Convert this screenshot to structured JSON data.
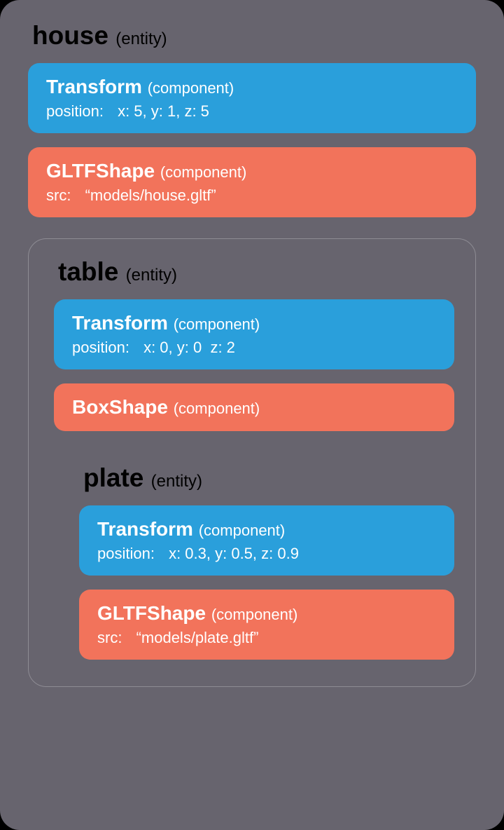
{
  "entities": {
    "house": {
      "name": "house",
      "tag": "(entity)",
      "transform": {
        "title": "Transform",
        "tag": "(component)",
        "prop_key": "position:",
        "prop_val": "x: 5, y: 1, z: 5"
      },
      "shape": {
        "title": "GLTFShape",
        "tag": "(component)",
        "prop_key": "src:",
        "prop_val": "“models/house.gltf”"
      }
    },
    "table": {
      "name": "table",
      "tag": "(entity)",
      "transform": {
        "title": "Transform",
        "tag": "(component)",
        "prop_key": "position:",
        "prop_val": "x: 0, y: 0  z: 2"
      },
      "shape": {
        "title": "BoxShape",
        "tag": "(component)"
      }
    },
    "plate": {
      "name": "plate",
      "tag": "(entity)",
      "transform": {
        "title": "Transform",
        "tag": "(component)",
        "prop_key": "position:",
        "prop_val": "x: 0.3, y: 0.5, z: 0.9"
      },
      "shape": {
        "title": "GLTFShape",
        "tag": "(component)",
        "prop_key": "src:",
        "prop_val": "“models/plate.gltf”"
      }
    }
  }
}
